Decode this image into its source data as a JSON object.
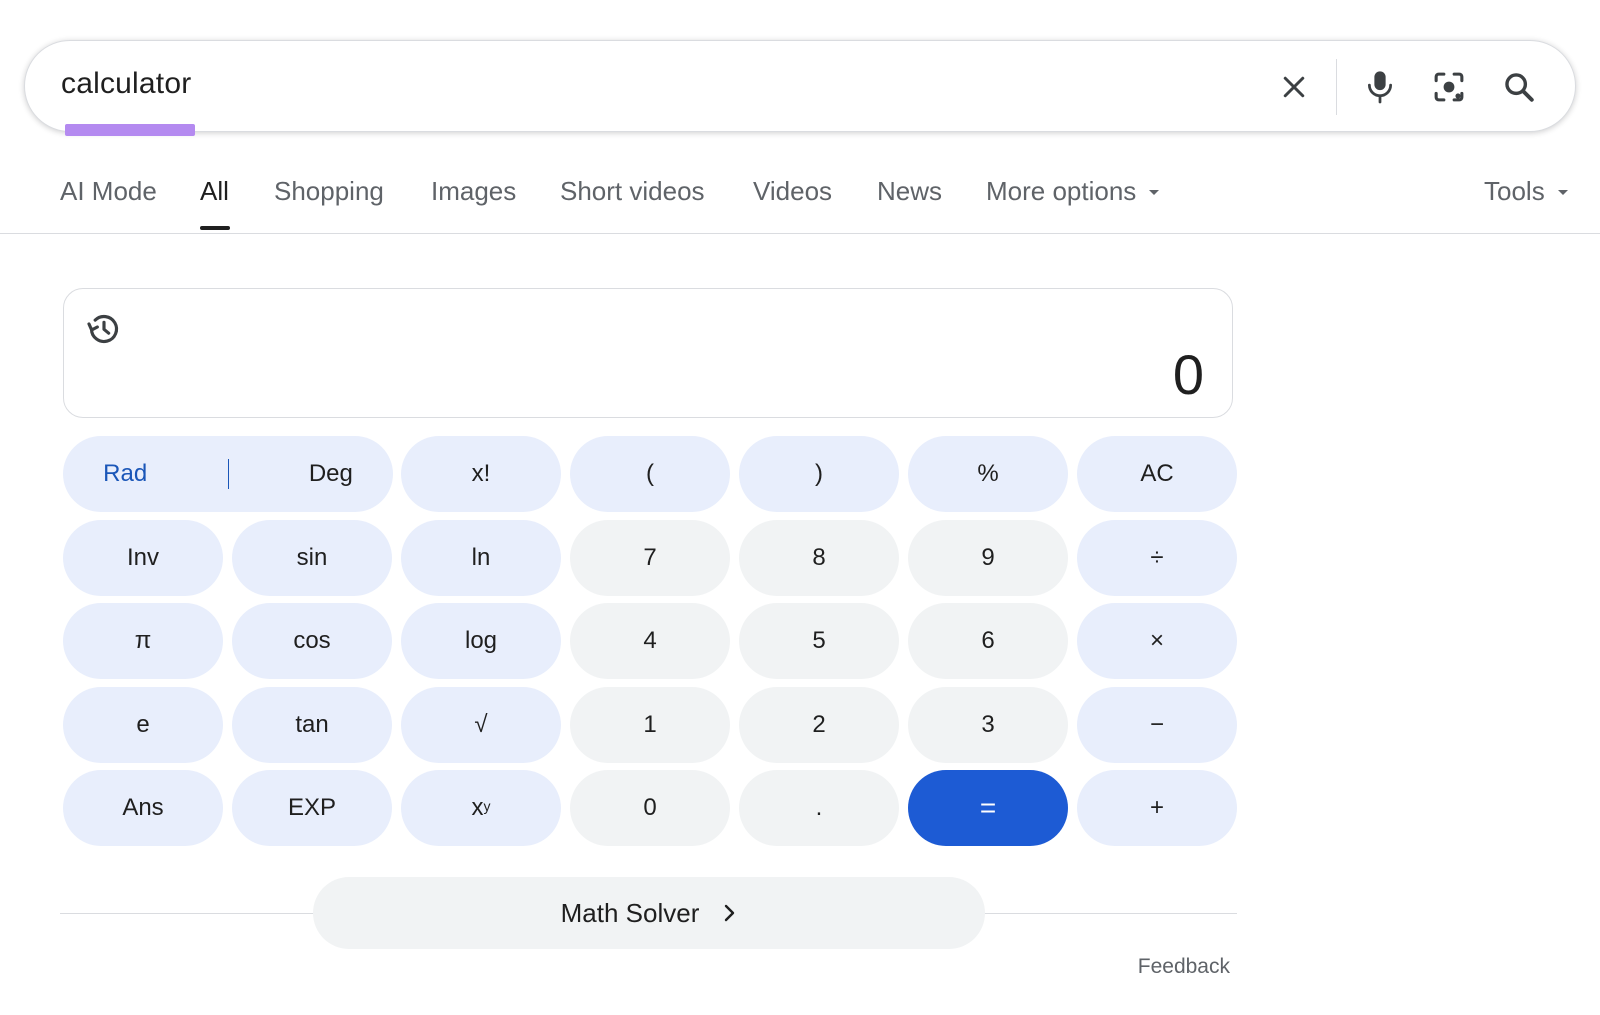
{
  "search": {
    "query": "calculator",
    "icons": [
      "close-icon",
      "microphone-icon",
      "lens-icon",
      "search-icon"
    ]
  },
  "tabs": {
    "items": [
      {
        "label": "AI Mode"
      },
      {
        "label": "All"
      },
      {
        "label": "Shopping"
      },
      {
        "label": "Images"
      },
      {
        "label": "Short videos"
      },
      {
        "label": "Videos"
      },
      {
        "label": "News"
      },
      {
        "label": "More options"
      }
    ],
    "active": "All",
    "tools_label": "Tools"
  },
  "calculator": {
    "display_value": "0",
    "mode": {
      "rad": "Rad",
      "deg": "Deg",
      "selected": "Rad"
    },
    "keys": {
      "factorial": "x!",
      "lparen": "(",
      "rparen": ")",
      "percent": "%",
      "clear": "AC",
      "inv": "Inv",
      "sin": "sin",
      "ln": "ln",
      "seven": "7",
      "eight": "8",
      "nine": "9",
      "divide": "÷",
      "pi": "π",
      "cos": "cos",
      "log": "log",
      "four": "4",
      "five": "5",
      "six": "6",
      "multiply": "×",
      "e": "e",
      "tan": "tan",
      "sqrt": "√",
      "one": "1",
      "two": "2",
      "three": "3",
      "minus": "−",
      "ans": "Ans",
      "exp": "EXP",
      "power_base": "x",
      "power_exp": "y",
      "zero": "0",
      "decimal": ".",
      "equals": "=",
      "plus": "+"
    },
    "colors": {
      "function_key": "#e8eefc",
      "number_key": "#f1f3f4",
      "equals_key": "#1d5bd4",
      "mode_selected": "#1a56b8"
    }
  },
  "footer": {
    "math_solver_label": "Math Solver",
    "feedback_label": "Feedback"
  }
}
